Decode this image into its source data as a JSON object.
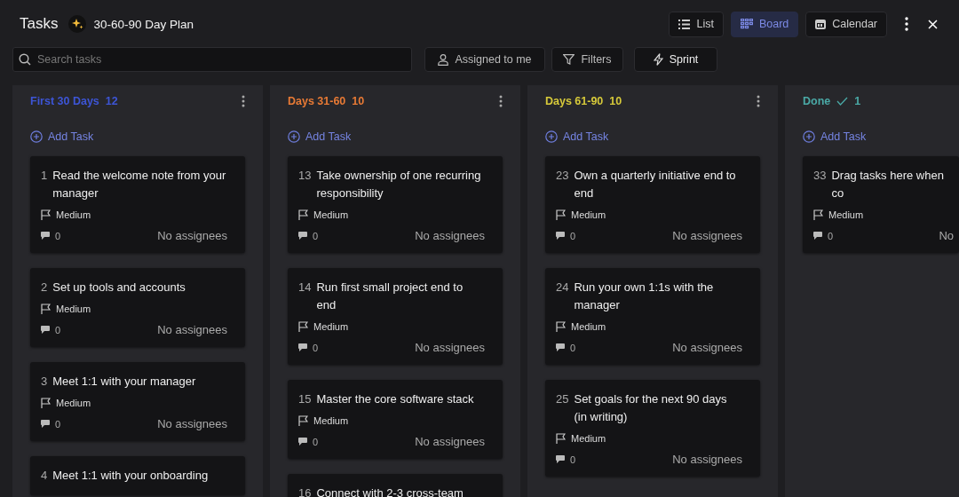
{
  "header": {
    "title": "Tasks",
    "plan": "30-60-90 Day Plan"
  },
  "views": [
    {
      "label": "List",
      "selected": false
    },
    {
      "label": "Board",
      "selected": true
    },
    {
      "label": "Calendar",
      "selected": false
    }
  ],
  "search": {
    "placeholder": "Search tasks"
  },
  "filters": [
    {
      "label": "Assigned to me"
    },
    {
      "label": "Filters"
    },
    {
      "label": "Sprint"
    }
  ],
  "columns": [
    {
      "title": "First 30 Days",
      "count": "12",
      "color": "#3d55d6",
      "done": false,
      "add": "Add Task",
      "cards": [
        {
          "num": "1",
          "title": "Read the welcome note from your manager",
          "priority": "Medium",
          "comments": "0",
          "assignees": "No assignees"
        },
        {
          "num": "2",
          "title": "Set up tools and accounts",
          "priority": "Medium",
          "comments": "0",
          "assignees": "No assignees"
        },
        {
          "num": "3",
          "title": "Meet 1:1 with your manager",
          "priority": "Medium",
          "comments": "0",
          "assignees": "No assignees"
        },
        {
          "num": "4",
          "title": "Meet 1:1 with your onboarding"
        }
      ]
    },
    {
      "title": "Days 31-60",
      "count": "10",
      "color": "#e87a35",
      "done": false,
      "add": "Add Task",
      "cards": [
        {
          "num": "13",
          "title": "Take ownership of one recurring responsibility",
          "priority": "Medium",
          "comments": "0",
          "assignees": "No assignees"
        },
        {
          "num": "14",
          "title": "Run first small project end to end",
          "priority": "Medium",
          "comments": "0",
          "assignees": "No assignees"
        },
        {
          "num": "15",
          "title": "Master the core software stack",
          "priority": "Medium",
          "comments": "0",
          "assignees": "No assignees"
        },
        {
          "num": "16",
          "title": "Connect with 2-3 cross-team"
        }
      ]
    },
    {
      "title": "Days 61-90",
      "count": "10",
      "color": "#d6c93a",
      "done": false,
      "add": "Add Task",
      "cards": [
        {
          "num": "23",
          "title": "Own a quarterly initiative end to end",
          "priority": "Medium",
          "comments": "0",
          "assignees": "No assignees"
        },
        {
          "num": "24",
          "title": "Run your own 1:1s with the manager",
          "priority": "Medium",
          "comments": "0",
          "assignees": "No assignees"
        },
        {
          "num": "25",
          "title": "Set goals for the next 90 days (in writing)",
          "priority": "Medium",
          "comments": "0",
          "assignees": "No assignees"
        }
      ]
    },
    {
      "title": "Done",
      "count": "1",
      "color": "#4aa9a6",
      "done": true,
      "add": "Add Task",
      "cards": [
        {
          "num": "33",
          "title": "Drag tasks here when co",
          "priority": "Medium",
          "comments": "0",
          "assignees": "No"
        }
      ]
    }
  ]
}
